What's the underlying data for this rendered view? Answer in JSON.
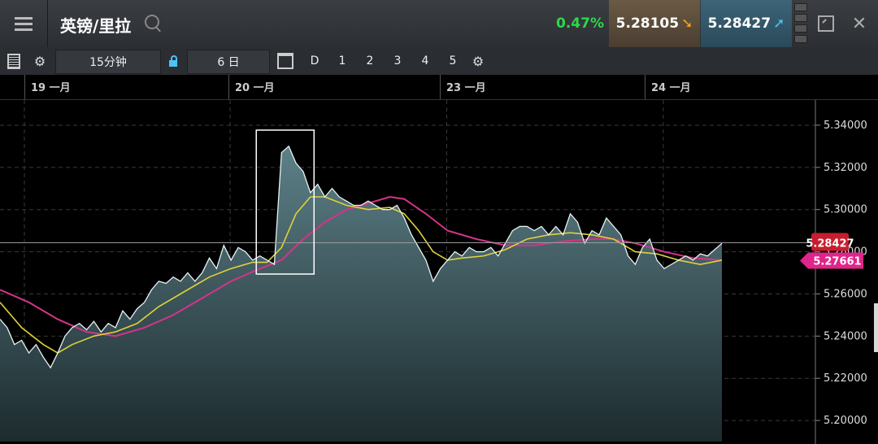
{
  "header": {
    "title": "英镑/里拉",
    "change_pct": "0.47%",
    "bid": "5.28105",
    "ask": "5.28427"
  },
  "toolbar": {
    "interval": "15分钟",
    "range": "6 日",
    "period_buttons": [
      "D",
      "1",
      "2",
      "3",
      "4",
      "5"
    ]
  },
  "dates": [
    "19 一月",
    "20 一月",
    "23 一月",
    "24 一月"
  ],
  "price_tags": {
    "last": "5.28427",
    "ma": "5.27661"
  },
  "chart_data": {
    "type": "area",
    "ylim": [
      5.19,
      5.35
    ],
    "yticks": [
      "5.34000",
      "5.32000",
      "5.30000",
      "5.28000",
      "5.26000",
      "5.24000",
      "5.22000",
      "5.20000"
    ],
    "ytick_values": [
      5.34,
      5.32,
      5.3,
      5.28,
      5.26,
      5.24,
      5.22,
      5.2
    ],
    "x_range": [
      0,
      100
    ],
    "last_price": 5.28427,
    "price": [
      [
        0,
        5.248
      ],
      [
        1,
        5.244
      ],
      [
        2,
        5.236
      ],
      [
        3,
        5.238
      ],
      [
        4,
        5.232
      ],
      [
        5,
        5.236
      ],
      [
        6,
        5.23
      ],
      [
        7,
        5.225
      ],
      [
        8,
        5.232
      ],
      [
        9,
        5.24
      ],
      [
        10,
        5.244
      ],
      [
        11,
        5.246
      ],
      [
        12,
        5.243
      ],
      [
        13,
        5.247
      ],
      [
        14,
        5.242
      ],
      [
        15,
        5.246
      ],
      [
        16,
        5.244
      ],
      [
        17,
        5.252
      ],
      [
        18,
        5.248
      ],
      [
        19,
        5.253
      ],
      [
        20,
        5.256
      ],
      [
        21,
        5.262
      ],
      [
        22,
        5.266
      ],
      [
        23,
        5.265
      ],
      [
        24,
        5.268
      ],
      [
        25,
        5.266
      ],
      [
        26,
        5.27
      ],
      [
        27,
        5.266
      ],
      [
        28,
        5.27
      ],
      [
        29,
        5.277
      ],
      [
        30,
        5.272
      ],
      [
        31,
        5.283
      ],
      [
        32,
        5.276
      ],
      [
        33,
        5.282
      ],
      [
        34,
        5.28
      ],
      [
        35,
        5.276
      ],
      [
        36,
        5.278
      ],
      [
        37,
        5.276
      ],
      [
        38,
        5.274
      ],
      [
        39,
        5.327
      ],
      [
        40,
        5.33
      ],
      [
        41,
        5.322
      ],
      [
        42,
        5.318
      ],
      [
        43,
        5.308
      ],
      [
        44,
        5.312
      ],
      [
        45,
        5.306
      ],
      [
        46,
        5.31
      ],
      [
        47,
        5.306
      ],
      [
        48,
        5.304
      ],
      [
        49,
        5.302
      ],
      [
        50,
        5.302
      ],
      [
        51,
        5.304
      ],
      [
        52,
        5.302
      ],
      [
        53,
        5.3
      ],
      [
        54,
        5.3
      ],
      [
        55,
        5.302
      ],
      [
        56,
        5.296
      ],
      [
        57,
        5.288
      ],
      [
        58,
        5.282
      ],
      [
        59,
        5.276
      ],
      [
        60,
        5.266
      ],
      [
        61,
        5.272
      ],
      [
        62,
        5.276
      ],
      [
        63,
        5.28
      ],
      [
        64,
        5.278
      ],
      [
        65,
        5.282
      ],
      [
        66,
        5.28
      ],
      [
        67,
        5.28
      ],
      [
        68,
        5.282
      ],
      [
        69,
        5.278
      ],
      [
        70,
        5.284
      ],
      [
        71,
        5.29
      ],
      [
        72,
        5.292
      ],
      [
        73,
        5.292
      ],
      [
        74,
        5.29
      ],
      [
        75,
        5.292
      ],
      [
        76,
        5.288
      ],
      [
        77,
        5.292
      ],
      [
        78,
        5.288
      ],
      [
        79,
        5.298
      ],
      [
        80,
        5.294
      ],
      [
        81,
        5.284
      ],
      [
        82,
        5.29
      ],
      [
        83,
        5.288
      ],
      [
        84,
        5.296
      ],
      [
        85,
        5.292
      ],
      [
        86,
        5.288
      ],
      [
        87,
        5.278
      ],
      [
        88,
        5.274
      ],
      [
        89,
        5.282
      ],
      [
        90,
        5.286
      ],
      [
        91,
        5.276
      ],
      [
        92,
        5.272
      ],
      [
        93,
        5.274
      ],
      [
        94,
        5.276
      ],
      [
        95,
        5.278
      ],
      [
        96,
        5.276
      ],
      [
        97,
        5.279
      ],
      [
        98,
        5.278
      ],
      [
        99,
        5.281
      ],
      [
        100,
        5.284
      ]
    ],
    "ma_fast": [
      [
        0,
        5.256
      ],
      [
        3,
        5.244
      ],
      [
        6,
        5.236
      ],
      [
        8,
        5.232
      ],
      [
        10,
        5.236
      ],
      [
        13,
        5.24
      ],
      [
        16,
        5.242
      ],
      [
        19,
        5.246
      ],
      [
        22,
        5.254
      ],
      [
        26,
        5.262
      ],
      [
        29,
        5.268
      ],
      [
        32,
        5.272
      ],
      [
        35,
        5.275
      ],
      [
        37,
        5.275
      ],
      [
        39,
        5.282
      ],
      [
        41,
        5.298
      ],
      [
        43,
        5.306
      ],
      [
        45,
        5.306
      ],
      [
        48,
        5.302
      ],
      [
        51,
        5.3
      ],
      [
        54,
        5.301
      ],
      [
        56,
        5.298
      ],
      [
        58,
        5.29
      ],
      [
        60,
        5.28
      ],
      [
        62,
        5.276
      ],
      [
        64,
        5.277
      ],
      [
        67,
        5.278
      ],
      [
        70,
        5.281
      ],
      [
        73,
        5.286
      ],
      [
        76,
        5.288
      ],
      [
        79,
        5.289
      ],
      [
        82,
        5.288
      ],
      [
        85,
        5.286
      ],
      [
        88,
        5.28
      ],
      [
        91,
        5.279
      ],
      [
        94,
        5.276
      ],
      [
        97,
        5.274
      ],
      [
        100,
        5.276
      ]
    ],
    "ma_slow": [
      [
        0,
        5.262
      ],
      [
        4,
        5.256
      ],
      [
        8,
        5.248
      ],
      [
        12,
        5.242
      ],
      [
        16,
        5.24
      ],
      [
        20,
        5.244
      ],
      [
        24,
        5.25
      ],
      [
        28,
        5.258
      ],
      [
        32,
        5.266
      ],
      [
        36,
        5.272
      ],
      [
        39,
        5.276
      ],
      [
        42,
        5.286
      ],
      [
        45,
        5.294
      ],
      [
        48,
        5.3
      ],
      [
        51,
        5.303
      ],
      [
        54,
        5.306
      ],
      [
        56,
        5.305
      ],
      [
        59,
        5.298
      ],
      [
        62,
        5.29
      ],
      [
        66,
        5.286
      ],
      [
        70,
        5.283
      ],
      [
        74,
        5.283
      ],
      [
        78,
        5.285
      ],
      [
        82,
        5.286
      ],
      [
        85,
        5.286
      ],
      [
        88,
        5.284
      ],
      [
        92,
        5.28
      ],
      [
        96,
        5.277
      ],
      [
        100,
        5.276
      ]
    ],
    "date_breaks": [
      0,
      28.5,
      58.5,
      88.5
    ],
    "highlight_x": [
      35.5,
      43.5
    ]
  }
}
